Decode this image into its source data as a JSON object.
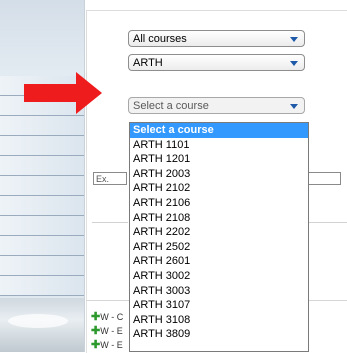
{
  "filters": {
    "all_courses": "All courses",
    "subject": "ARTH",
    "course_placeholder": "Select a course"
  },
  "search_input": {
    "value": "Ex. 100"
  },
  "dropdown": {
    "options": [
      "Select a course",
      "ARTH 1101",
      "ARTH 1201",
      "ARTH 2003",
      "ARTH 2102",
      "ARTH 2106",
      "ARTH 2108",
      "ARTH 2202",
      "ARTH 2502",
      "ARTH 2601",
      "ARTH 3002",
      "ARTH 3003",
      "ARTH 3107",
      "ARTH 3108",
      "ARTH 3809"
    ],
    "selected_index": 0
  },
  "legend": [
    {
      "icon": "plus-icon",
      "label": "W - C"
    },
    {
      "icon": "plus-icon",
      "label": "W - E"
    },
    {
      "icon": "plus-icon",
      "label": "W - E"
    }
  ],
  "colors": {
    "arrow": "#ee1c1c",
    "selection": "#3399ff",
    "plus": "#2e9a2e",
    "select_arrow": "#1e5aa8"
  }
}
